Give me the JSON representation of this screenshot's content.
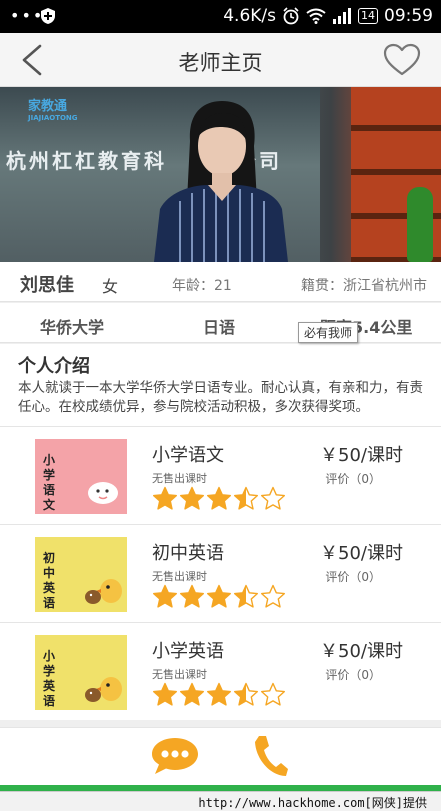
{
  "status_bar": {
    "dots": "•••",
    "speed": "4.6K/s",
    "battery": "14",
    "time": "09:59"
  },
  "nav": {
    "title": "老师主页",
    "back_icon": "back-chevron-icon",
    "favorite_icon": "heart-outline-icon"
  },
  "banner": {
    "logo_text": "家教通",
    "logo_sub": "JIAJIAOTONG",
    "company_text": "杭州杠杠教育科　　　公司"
  },
  "teacher": {
    "name": "刘思佳",
    "gender": "女",
    "age": "年龄：21",
    "origin": "籍贯：浙江省杭州市",
    "school": "华侨大学",
    "subject": "日语",
    "distance": "距离5.4公里"
  },
  "tooltip": "必有我师",
  "intro": {
    "heading": "个人介绍",
    "text": "本人就读于一本大学华侨大学日语专业。耐心认真，有亲和力，有责任心。在校成绩优异，参与院校活动积极，多次获得奖项。"
  },
  "courses": [
    {
      "name": "小学语文",
      "sold": "无售出课时",
      "price": "￥50/课时",
      "review": "评价（0）",
      "rating": 3.5,
      "thumb_text": "小学语文",
      "thumb_color": "#f4a3a8"
    },
    {
      "name": "初中英语",
      "sold": "无售出课时",
      "price": "￥50/课时",
      "review": "评价（0）",
      "rating": 3.5,
      "thumb_text": "初中英语",
      "thumb_color": "#f0e16a"
    },
    {
      "name": "小学英语",
      "sold": "无售出课时",
      "price": "￥50/课时",
      "review": "评价（0）",
      "rating": 3.5,
      "thumb_text": "小学英语",
      "thumb_color": "#f0e16a"
    }
  ],
  "actions": {
    "chat_icon": "chat-bubble-icon",
    "phone_icon": "phone-icon",
    "accent_color": "#f5a623"
  },
  "watermark": "http://www.hackhome.com[网侠]提供"
}
